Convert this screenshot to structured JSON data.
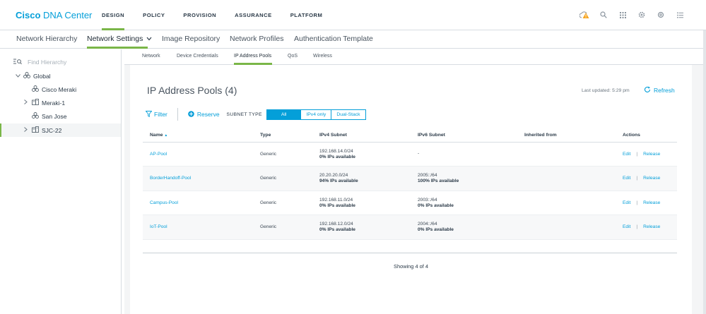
{
  "header": {
    "brand_bold": "Cisco",
    "brand_rest": " DNA Center",
    "nav": [
      {
        "label": "DESIGN",
        "active": true
      },
      {
        "label": "POLICY",
        "active": false
      },
      {
        "label": "PROVISION",
        "active": false
      },
      {
        "label": "ASSURANCE",
        "active": false
      },
      {
        "label": "PLATFORM",
        "active": false
      }
    ],
    "icons": [
      "alert-icon",
      "search-icon",
      "apps-grid-icon",
      "gear-icon",
      "tools-icon",
      "menu-list-icon"
    ],
    "alert_color": "#f6a623"
  },
  "subnav": {
    "items": [
      "Network Hierarchy",
      "Network Settings",
      "Image Repository",
      "Network Profiles",
      "Authentication Template"
    ],
    "active_index": 1
  },
  "sidebar": {
    "search_placeholder": "Find Hierarchy",
    "tree": [
      {
        "label": "Global",
        "expandable": "open"
      },
      {
        "label": "Cisco Meraki",
        "expandable": "none"
      },
      {
        "label": "Meraki-1",
        "expandable": "closed"
      },
      {
        "label": "San Jose",
        "expandable": "none"
      },
      {
        "label": "SJC-22",
        "expandable": "closed",
        "selected": true
      }
    ]
  },
  "tabs": {
    "items": [
      "Network",
      "Device Credentials",
      "IP Address Pools",
      "QoS",
      "Wireless"
    ],
    "active_index": 2
  },
  "pools": {
    "title": "IP Address Pools (4)",
    "last_updated": "Last updated: 5:29 pm",
    "refresh_label": "Refresh",
    "filter_label": "Filter",
    "reserve_label": "Reserve",
    "subnet_type_label": "SUBNET TYPE",
    "subnet_options": [
      "All",
      "IPv4 only",
      "Dual-Stack"
    ],
    "subnet_selected": "All",
    "columns": [
      "Name",
      "Type",
      "IPv4 Subnet",
      "IPv6 Subnet",
      "Inherited from",
      "Actions"
    ],
    "rows": [
      {
        "name": "AP-Pool",
        "type": "Generic",
        "ipv4": "192.168.14.0/24",
        "ipv4_avail": "0% IPs available",
        "ipv6": "-",
        "ipv6_avail": "",
        "inherited": "",
        "edit": "Edit",
        "release": "Release"
      },
      {
        "name": "BorderHandoff-Pool",
        "type": "Generic",
        "ipv4": "20.20.20.0/24",
        "ipv4_avail": "94% IPs available",
        "ipv6": "2005::/64",
        "ipv6_avail": "100% IPs available",
        "inherited": "",
        "edit": "Edit",
        "release": "Release"
      },
      {
        "name": "Campus-Pool",
        "type": "Generic",
        "ipv4": "192.168.11.0/24",
        "ipv4_avail": "0% IPs available",
        "ipv6": "2003::/64",
        "ipv6_avail": "0% IPs available",
        "inherited": "",
        "edit": "Edit",
        "release": "Release"
      },
      {
        "name": "IoT-Pool",
        "type": "Generic",
        "ipv4": "192.168.12.0/24",
        "ipv4_avail": "0% IPs available",
        "ipv6": "2004::/64",
        "ipv6_avail": "0% IPs available",
        "inherited": "",
        "edit": "Edit",
        "release": "Release"
      }
    ],
    "showing": "Showing 4 of 4"
  },
  "colors": {
    "accent": "#049fd9",
    "active_underline": "#7ab648"
  }
}
